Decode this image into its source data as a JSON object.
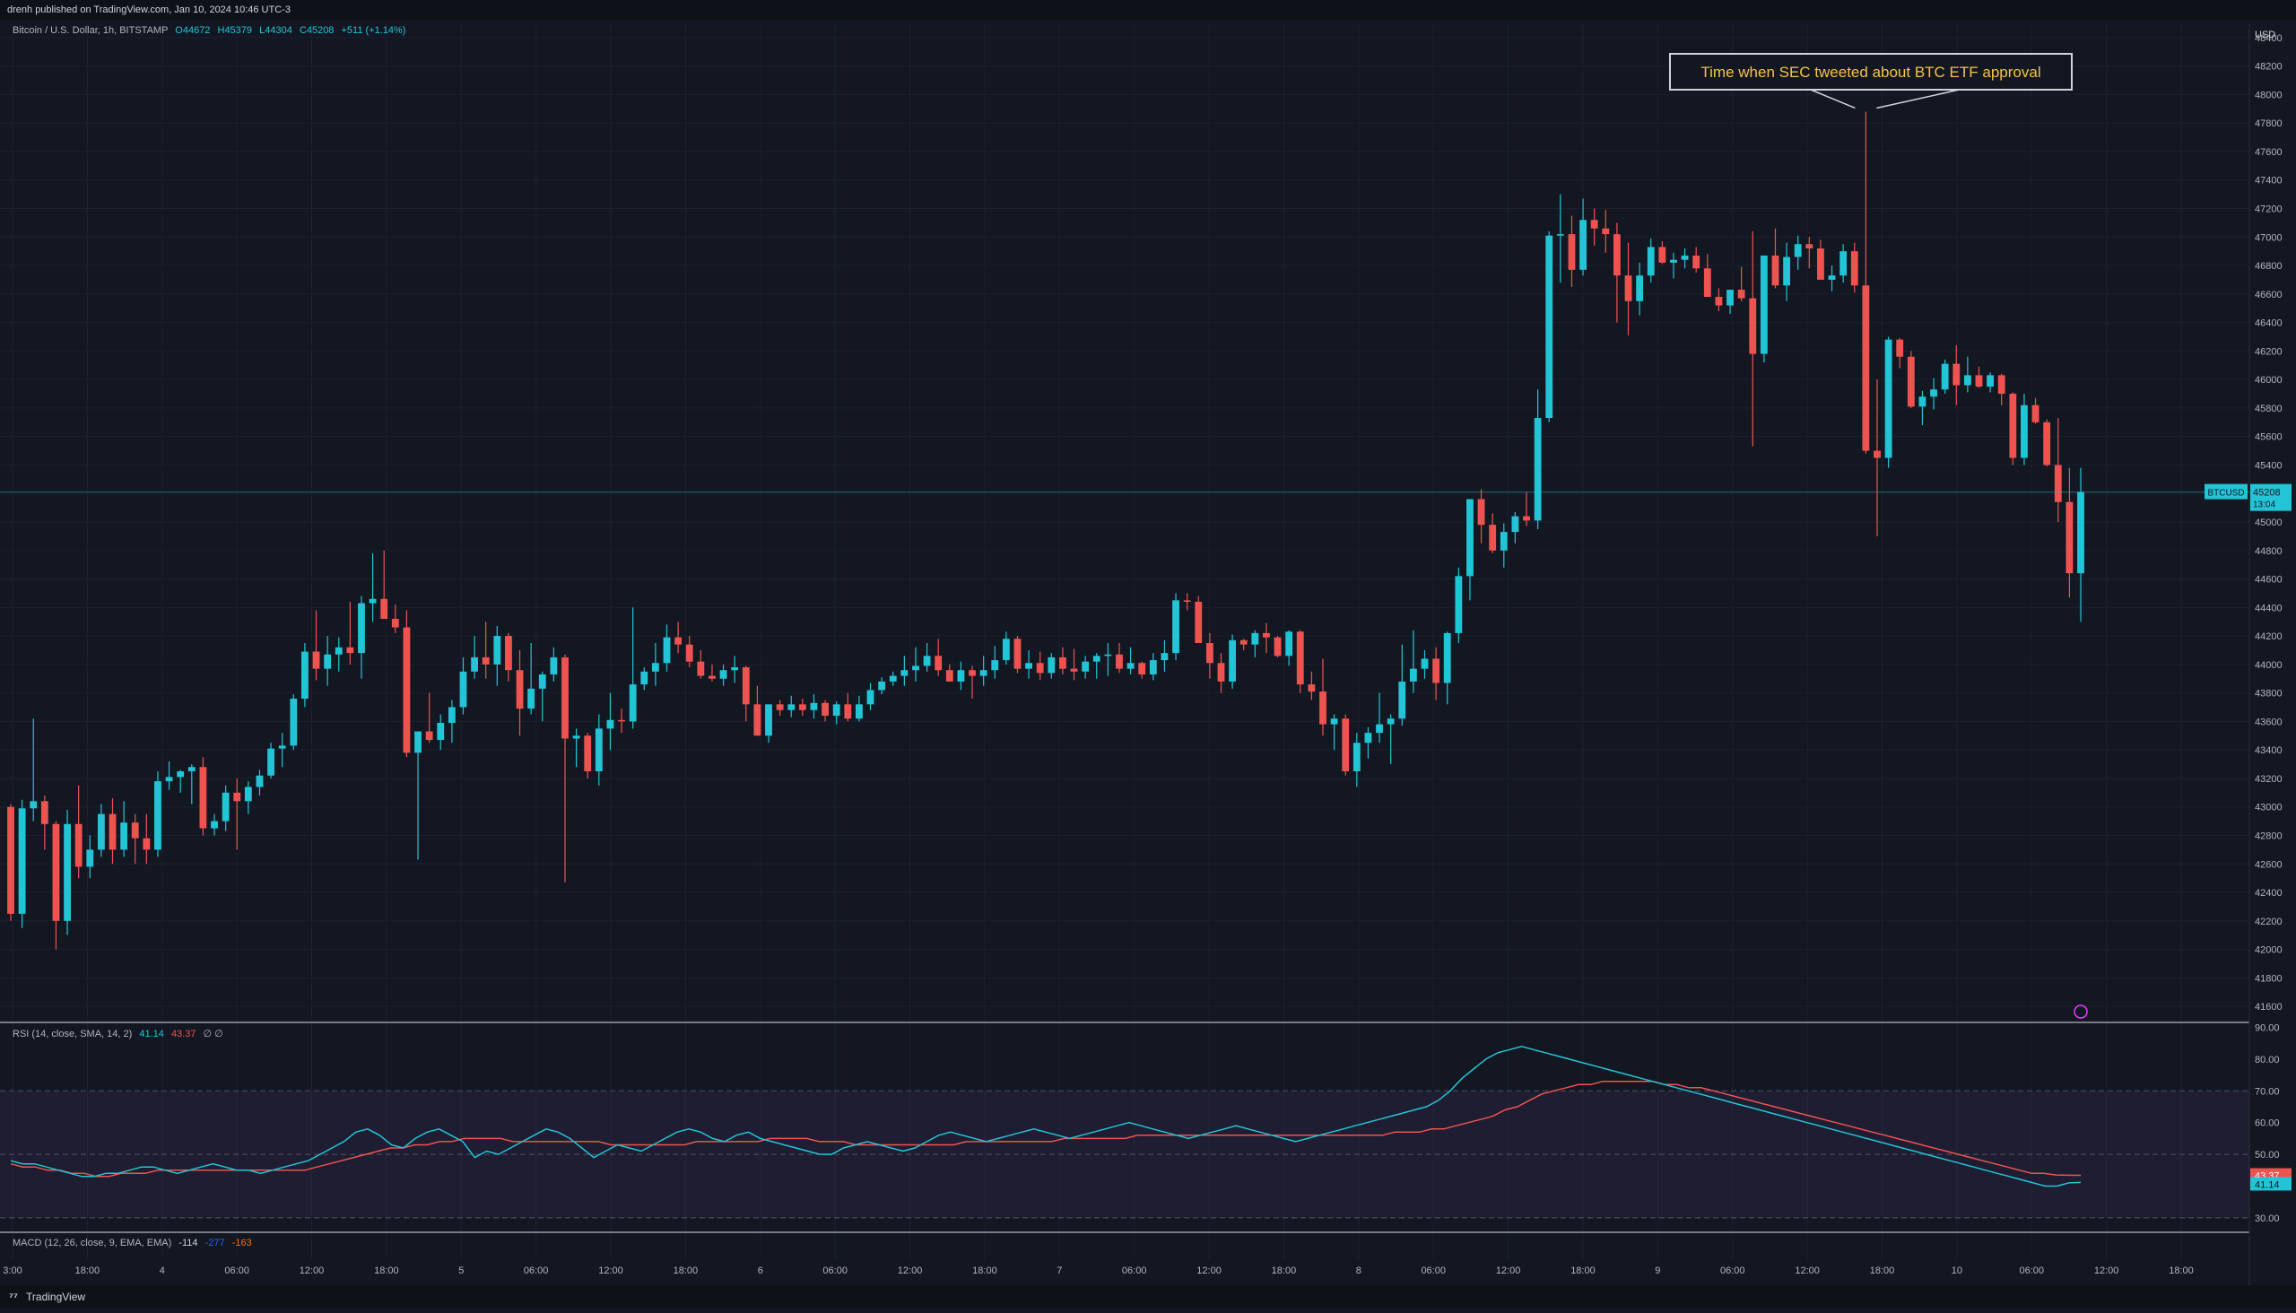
{
  "header": {
    "published": "drenh published on TradingView.com, Jan 10, 2024 10:46 UTC-3"
  },
  "legend": {
    "symbol": "Bitcoin / U.S. Dollar, 1h, BITSTAMP",
    "open": "O44672",
    "high": "H45379",
    "low": "L44304",
    "close": "C45208",
    "change": "+511 (+1.14%)"
  },
  "rsi_legend": {
    "label": "RSI (14, close, SMA, 14, 2)",
    "rsi": "41.14",
    "sma": "43.37",
    "extra": "∅ ∅"
  },
  "macd_legend": {
    "label": "MACD (12, 26, close, 9, EMA, EMA)",
    "macd": "-114",
    "signal": "-277",
    "hist": "-163"
  },
  "annotation": {
    "text": "Time when SEC tweeted about BTC ETF approval"
  },
  "price_tag": {
    "symbol": "BTCUSD",
    "price": "45208",
    "countdown": "13:04"
  },
  "rsi_tags": {
    "sma": "43.37",
    "rsi": "41.14"
  },
  "currency": "USD",
  "footer": {
    "brand": "TradingView"
  },
  "colors": {
    "up": "#22c5d6",
    "down": "#ef5350",
    "background": "#131722",
    "rsi_line": "#22c5d6",
    "rsi_sma": "#ef5350",
    "annotation": "#f6c343"
  },
  "chart_data": {
    "type": "candlestick",
    "price_axis": {
      "ticks": [
        41600,
        41800,
        42000,
        42200,
        42400,
        42600,
        42800,
        43000,
        43200,
        43400,
        43600,
        43800,
        44000,
        44200,
        44400,
        44600,
        44800,
        45000,
        45200,
        45400,
        45600,
        45800,
        46000,
        46200,
        46400,
        46600,
        46800,
        47000,
        47200,
        47400,
        47600,
        47800,
        48000,
        48200,
        48400
      ],
      "range": [
        41500,
        48500
      ]
    },
    "time_axis": [
      "3:00",
      "18:00",
      "4",
      "06:00",
      "12:00",
      "18:00",
      "5",
      "06:00",
      "12:00",
      "18:00",
      "6",
      "06:00",
      "12:00",
      "18:00",
      "7",
      "06:00",
      "12:00",
      "18:00",
      "8",
      "06:00",
      "12:00",
      "18:00",
      "9",
      "06:00",
      "12:00",
      "18:00",
      "10",
      "06:00",
      "12:00",
      "18:00"
    ],
    "rsi_axis": {
      "ticks": [
        30.0,
        40.0,
        50.0,
        60.0,
        70.0,
        80.0,
        90.0
      ],
      "range": [
        26,
        91
      ],
      "bands": [
        30,
        50,
        70
      ]
    },
    "candles": [
      [
        43000,
        43020,
        42200,
        42250
      ],
      [
        42250,
        43050,
        42150,
        42990
      ],
      [
        42990,
        43620,
        42900,
        43040
      ],
      [
        43040,
        43080,
        42700,
        42880
      ],
      [
        42880,
        42900,
        42000,
        42200
      ],
      [
        42200,
        42980,
        42100,
        42880
      ],
      [
        42880,
        43150,
        42500,
        42580
      ],
      [
        42580,
        42800,
        42500,
        42700
      ],
      [
        42700,
        43020,
        42650,
        42950
      ],
      [
        42950,
        43060,
        42600,
        42700
      ],
      [
        42700,
        43040,
        42650,
        42890
      ],
      [
        42890,
        42950,
        42600,
        42780
      ],
      [
        42780,
        42950,
        42600,
        42700
      ],
      [
        42700,
        43250,
        42650,
        43180
      ],
      [
        43180,
        43320,
        43120,
        43210
      ],
      [
        43210,
        43260,
        43100,
        43250
      ],
      [
        43250,
        43300,
        43020,
        43280
      ],
      [
        43280,
        43350,
        42800,
        42850
      ],
      [
        42850,
        42950,
        42800,
        42900
      ],
      [
        42900,
        43150,
        42830,
        43100
      ],
      [
        43100,
        43200,
        42700,
        43040
      ],
      [
        43040,
        43180,
        42950,
        43140
      ],
      [
        43140,
        43260,
        43080,
        43220
      ],
      [
        43220,
        43450,
        43200,
        43410
      ],
      [
        43410,
        43520,
        43280,
        43430
      ],
      [
        43430,
        43790,
        43400,
        43760
      ],
      [
        43760,
        44150,
        43700,
        44090
      ],
      [
        44090,
        44380,
        43890,
        43970
      ],
      [
        43970,
        44200,
        43850,
        44070
      ],
      [
        44070,
        44190,
        43950,
        44120
      ],
      [
        44120,
        44440,
        44000,
        44080
      ],
      [
        44080,
        44480,
        43900,
        44430
      ],
      [
        44430,
        44780,
        44300,
        44460
      ],
      [
        44460,
        44800,
        44350,
        44320
      ],
      [
        44320,
        44420,
        44220,
        44260
      ],
      [
        44260,
        44380,
        43350,
        43380
      ],
      [
        43380,
        43500,
        42630,
        43530
      ],
      [
        43530,
        43800,
        43450,
        43470
      ],
      [
        43470,
        43650,
        43400,
        43590
      ],
      [
        43590,
        43750,
        43450,
        43700
      ],
      [
        43700,
        44050,
        43650,
        43950
      ],
      [
        43950,
        44200,
        43900,
        44050
      ],
      [
        44050,
        44300,
        43900,
        44000
      ],
      [
        44000,
        44270,
        43850,
        44200
      ],
      [
        44200,
        44220,
        43880,
        43960
      ],
      [
        43960,
        44100,
        43500,
        43690
      ],
      [
        43690,
        44150,
        43650,
        43830
      ],
      [
        43830,
        43950,
        43600,
        43930
      ],
      [
        43930,
        44120,
        43880,
        44050
      ],
      [
        44050,
        44070,
        42470,
        43480
      ],
      [
        43480,
        43550,
        43280,
        43500
      ],
      [
        43500,
        43520,
        43200,
        43250
      ],
      [
        43250,
        43650,
        43150,
        43550
      ],
      [
        43550,
        43800,
        43400,
        43610
      ],
      [
        43610,
        43690,
        43520,
        43600
      ],
      [
        43600,
        44400,
        43550,
        43860
      ],
      [
        43860,
        43980,
        43820,
        43950
      ],
      [
        43950,
        44150,
        43850,
        44010
      ],
      [
        44010,
        44280,
        43950,
        44190
      ],
      [
        44190,
        44300,
        44080,
        44140
      ],
      [
        44140,
        44200,
        43980,
        44020
      ],
      [
        44020,
        44100,
        43900,
        43920
      ],
      [
        43920,
        44000,
        43880,
        43900
      ],
      [
        43900,
        44000,
        43850,
        43960
      ],
      [
        43960,
        44060,
        43870,
        43980
      ],
      [
        43980,
        43990,
        43600,
        43720
      ],
      [
        43720,
        43850,
        43650,
        43500
      ],
      [
        43500,
        43720,
        43450,
        43720
      ],
      [
        43720,
        43750,
        43640,
        43680
      ],
      [
        43680,
        43780,
        43630,
        43720
      ],
      [
        43720,
        43760,
        43640,
        43680
      ],
      [
        43680,
        43790,
        43620,
        43730
      ],
      [
        43730,
        43750,
        43600,
        43640
      ],
      [
        43640,
        43740,
        43580,
        43720
      ],
      [
        43720,
        43800,
        43600,
        43620
      ],
      [
        43620,
        43780,
        43600,
        43720
      ],
      [
        43720,
        43870,
        43680,
        43820
      ],
      [
        43820,
        43910,
        43790,
        43880
      ],
      [
        43880,
        43950,
        43850,
        43920
      ],
      [
        43920,
        44060,
        43850,
        43960
      ],
      [
        43960,
        44120,
        43880,
        43990
      ],
      [
        43990,
        44150,
        43950,
        44060
      ],
      [
        44060,
        44180,
        43920,
        43960
      ],
      [
        43960,
        44000,
        43880,
        43880
      ],
      [
        43880,
        44020,
        43820,
        43960
      ],
      [
        43960,
        43990,
        43760,
        43920
      ],
      [
        43920,
        44060,
        43850,
        43960
      ],
      [
        43960,
        44130,
        43900,
        44030
      ],
      [
        44030,
        44230,
        44000,
        44180
      ],
      [
        44180,
        44200,
        43940,
        43970
      ],
      [
        43970,
        44100,
        43900,
        44010
      ],
      [
        44010,
        44090,
        43890,
        43940
      ],
      [
        43940,
        44080,
        43900,
        44050
      ],
      [
        44050,
        44120,
        43930,
        43970
      ],
      [
        43970,
        44110,
        43890,
        43950
      ],
      [
        43950,
        44060,
        43900,
        44020
      ],
      [
        44020,
        44080,
        43900,
        44060
      ],
      [
        44060,
        44150,
        43920,
        44070
      ],
      [
        44070,
        44150,
        43940,
        43970
      ],
      [
        43970,
        44120,
        43930,
        44010
      ],
      [
        44010,
        44020,
        43900,
        43930
      ],
      [
        43930,
        44080,
        43890,
        44030
      ],
      [
        44030,
        44170,
        43950,
        44080
      ],
      [
        44080,
        44500,
        44030,
        44450
      ],
      [
        44450,
        44500,
        44380,
        44440
      ],
      [
        44440,
        44480,
        44150,
        44150
      ],
      [
        44150,
        44220,
        43900,
        44010
      ],
      [
        44010,
        44080,
        43800,
        43880
      ],
      [
        43880,
        44210,
        43830,
        44170
      ],
      [
        44170,
        44180,
        44100,
        44140
      ],
      [
        44140,
        44240,
        44050,
        44220
      ],
      [
        44220,
        44290,
        44080,
        44190
      ],
      [
        44190,
        44200,
        44050,
        44060
      ],
      [
        44060,
        44240,
        43990,
        44230
      ],
      [
        44230,
        44240,
        43800,
        43860
      ],
      [
        43860,
        43950,
        43750,
        43810
      ],
      [
        43810,
        44040,
        43500,
        43580
      ],
      [
        43580,
        43650,
        43400,
        43620
      ],
      [
        43620,
        43650,
        43220,
        43250
      ],
      [
        43250,
        43520,
        43140,
        43450
      ],
      [
        43450,
        43560,
        43340,
        43520
      ],
      [
        43520,
        43800,
        43450,
        43580
      ],
      [
        43580,
        43650,
        43300,
        43620
      ],
      [
        43620,
        44140,
        43570,
        43880
      ],
      [
        43880,
        44240,
        43800,
        43970
      ],
      [
        43970,
        44100,
        43900,
        44040
      ],
      [
        44040,
        44120,
        43750,
        43870
      ],
      [
        43870,
        44230,
        43720,
        44220
      ],
      [
        44220,
        44680,
        44150,
        44620
      ],
      [
        44620,
        44950,
        44450,
        45160
      ],
      [
        45160,
        45230,
        44850,
        44980
      ],
      [
        44980,
        45060,
        44780,
        44800
      ],
      [
        44800,
        44990,
        44680,
        44930
      ],
      [
        44930,
        45070,
        44850,
        45040
      ],
      [
        45040,
        45210,
        44970,
        45010
      ],
      [
        45010,
        45930,
        44950,
        45730
      ],
      [
        45730,
        47040,
        45700,
        47010
      ],
      [
        47010,
        47300,
        46680,
        47020
      ],
      [
        47020,
        47150,
        46650,
        46770
      ],
      [
        46770,
        47270,
        46730,
        47120
      ],
      [
        47120,
        47200,
        46940,
        47060
      ],
      [
        47060,
        47190,
        46890,
        47020
      ],
      [
        47020,
        47100,
        46400,
        46730
      ],
      [
        46730,
        46960,
        46310,
        46550
      ],
      [
        46550,
        46820,
        46450,
        46730
      ],
      [
        46730,
        46990,
        46680,
        46930
      ],
      [
        46930,
        46970,
        46810,
        46820
      ],
      [
        46820,
        46890,
        46710,
        46840
      ],
      [
        46840,
        46920,
        46780,
        46870
      ],
      [
        46870,
        46930,
        46750,
        46780
      ],
      [
        46780,
        46880,
        46600,
        46580
      ],
      [
        46580,
        46640,
        46480,
        46520
      ],
      [
        46520,
        46610,
        46460,
        46630
      ],
      [
        46630,
        46790,
        46550,
        46570
      ],
      [
        46570,
        47040,
        45530,
        46180
      ],
      [
        46180,
        46740,
        46120,
        46870
      ],
      [
        46870,
        47060,
        46640,
        46660
      ],
      [
        46660,
        46960,
        46550,
        46860
      ],
      [
        46860,
        47010,
        46770,
        46950
      ],
      [
        46950,
        47000,
        46780,
        46920
      ],
      [
        46920,
        46980,
        46750,
        46700
      ],
      [
        46700,
        46800,
        46620,
        46730
      ],
      [
        46730,
        46950,
        46680,
        46900
      ],
      [
        46900,
        46960,
        46610,
        46660
      ],
      [
        46660,
        47880,
        45480,
        45500
      ],
      [
        45500,
        46000,
        44900,
        45450
      ],
      [
        45450,
        46300,
        45380,
        46280
      ],
      [
        46280,
        46290,
        46080,
        46160
      ],
      [
        46160,
        46200,
        45800,
        45810
      ],
      [
        45810,
        45920,
        45680,
        45880
      ],
      [
        45880,
        46010,
        45790,
        45930
      ],
      [
        45930,
        46140,
        45900,
        46110
      ],
      [
        46110,
        46240,
        45820,
        45960
      ],
      [
        45960,
        46160,
        45910,
        46030
      ],
      [
        46030,
        46090,
        45940,
        45950
      ],
      [
        45950,
        46050,
        45910,
        46030
      ],
      [
        46030,
        46040,
        45820,
        45900
      ],
      [
        45900,
        45910,
        45400,
        45450
      ],
      [
        45450,
        45900,
        45400,
        45820
      ],
      [
        45820,
        45870,
        45690,
        45700
      ],
      [
        45700,
        45720,
        45390,
        45400
      ],
      [
        45400,
        45730,
        45000,
        45140
      ],
      [
        45140,
        45380,
        44470,
        44640
      ],
      [
        44640,
        45380,
        44300,
        45210
      ]
    ],
    "rsi": [
      48,
      47,
      47,
      46,
      45,
      44,
      43,
      43,
      44,
      44,
      45,
      46,
      46,
      45,
      44,
      45,
      46,
      47,
      46,
      45,
      45,
      44,
      45,
      46,
      47,
      48,
      50,
      52,
      54,
      57,
      58,
      56,
      53,
      52,
      55,
      57,
      58,
      56,
      54,
      49,
      51,
      50,
      52,
      54,
      56,
      58,
      57,
      55,
      52,
      49,
      51,
      53,
      52,
      51,
      53,
      55,
      57,
      58,
      57,
      55,
      54,
      56,
      57,
      55,
      54,
      53,
      52,
      51,
      50,
      50,
      52,
      53,
      54,
      53,
      52,
      51,
      52,
      54,
      56,
      57,
      56,
      55,
      54,
      55,
      56,
      57,
      58,
      57,
      56,
      55,
      56,
      57,
      58,
      59,
      60,
      59,
      58,
      57,
      56,
      55,
      56,
      57,
      58,
      59,
      58,
      57,
      56,
      55,
      54,
      55,
      56,
      57,
      58,
      59,
      60,
      61,
      62,
      63,
      64,
      65,
      67,
      70,
      74,
      77,
      80,
      82,
      83,
      84,
      83,
      82,
      81,
      80,
      79,
      78,
      77,
      76,
      75,
      74,
      73,
      72,
      71,
      70,
      69,
      68,
      67,
      66,
      65,
      64,
      63,
      62,
      61,
      60,
      59,
      58,
      57,
      56,
      55,
      54,
      53,
      52,
      51,
      50,
      49,
      48,
      47,
      46,
      45,
      44,
      43,
      42,
      41,
      40,
      40,
      41,
      41.14
    ],
    "rsi_sma": [
      47,
      46,
      46,
      45,
      45,
      44,
      44,
      43,
      43,
      44,
      44,
      44,
      45,
      45,
      45,
      45,
      45,
      45,
      45,
      45,
      45,
      45,
      45,
      45,
      45,
      46,
      47,
      48,
      49,
      50,
      51,
      52,
      52,
      53,
      53,
      54,
      54,
      55,
      55,
      55,
      55,
      54,
      54,
      54,
      54,
      54,
      54,
      54,
      54,
      53,
      53,
      53,
      53,
      53,
      53,
      53,
      54,
      54,
      54,
      54,
      54,
      54,
      55,
      55,
      55,
      55,
      54,
      54,
      54,
      53,
      53,
      53,
      53,
      53,
      53,
      53,
      53,
      53,
      54,
      54,
      54,
      54,
      54,
      54,
      54,
      54,
      55,
      55,
      55,
      55,
      55,
      55,
      56,
      56,
      56,
      56,
      56,
      56,
      56,
      56,
      56,
      56,
      56,
      56,
      56,
      56,
      56,
      56,
      56,
      56,
      56,
      56,
      56,
      57,
      57,
      57,
      58,
      58,
      59,
      60,
      61,
      62,
      64,
      65,
      67,
      69,
      70,
      71,
      72,
      72,
      73,
      73,
      73,
      73,
      73,
      72,
      72,
      71,
      71,
      70,
      69,
      68,
      67,
      66,
      65,
      64,
      63,
      62,
      61,
      60,
      59,
      58,
      57,
      56,
      55,
      54,
      53,
      52,
      51,
      50,
      49,
      48,
      47,
      46,
      45,
      44,
      44,
      43.5,
      43.4,
      43.37
    ]
  }
}
